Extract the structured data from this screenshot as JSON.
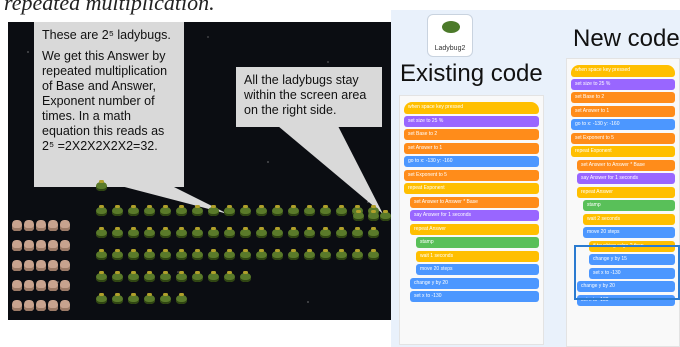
{
  "caption": "repeated multiplication.",
  "stage": {
    "callout1": {
      "line1": "These are 2⁵ ladybugs.",
      "line2": "We get this Answer by repeated multiplication of Base and Answer, Exponent number of times. In a math equation this reads as 2⁵ =2X2X2X2X2=32."
    },
    "callout2": "All the ladybugs stay within the screen area on the right side."
  },
  "sprite": {
    "name": "Ladybug2",
    "icon": "ladybug-icon"
  },
  "titles": {
    "existing": "Existing code",
    "new": "New code"
  },
  "code_existing": [
    "when space key pressed",
    "set size to 25 %",
    "set Base to 2",
    "set Answer to 1",
    "go to x: -130 y: -160",
    "set Exponent to 5",
    "repeat Exponent",
    "set Answer to Answer * Base",
    "say Answer for 1 seconds",
    "repeat Answer",
    "stamp",
    "wait 1 seconds",
    "move 20 steps",
    "change y by 20",
    "set x to -130"
  ],
  "code_new": [
    "when space key pressed",
    "set size to 25 %",
    "set Base to 2",
    "set Answer to 1",
    "go to x: -130 y: -160",
    "set Exponent to 5",
    "repeat Exponent",
    "set Answer to Answer * Base",
    "say Answer for 1 seconds",
    "repeat Answer",
    "stamp",
    "wait 2 seconds",
    "move 20 steps",
    "if touching edge ? then",
    "change y by 15",
    "set x to -130",
    "change y by 20",
    "set x to -130"
  ],
  "colors": {
    "motion": "#4c97ff",
    "looks": "#9966ff",
    "control": "#ffbf00",
    "variables": "#ff8c1a",
    "pen": "#59c059"
  }
}
